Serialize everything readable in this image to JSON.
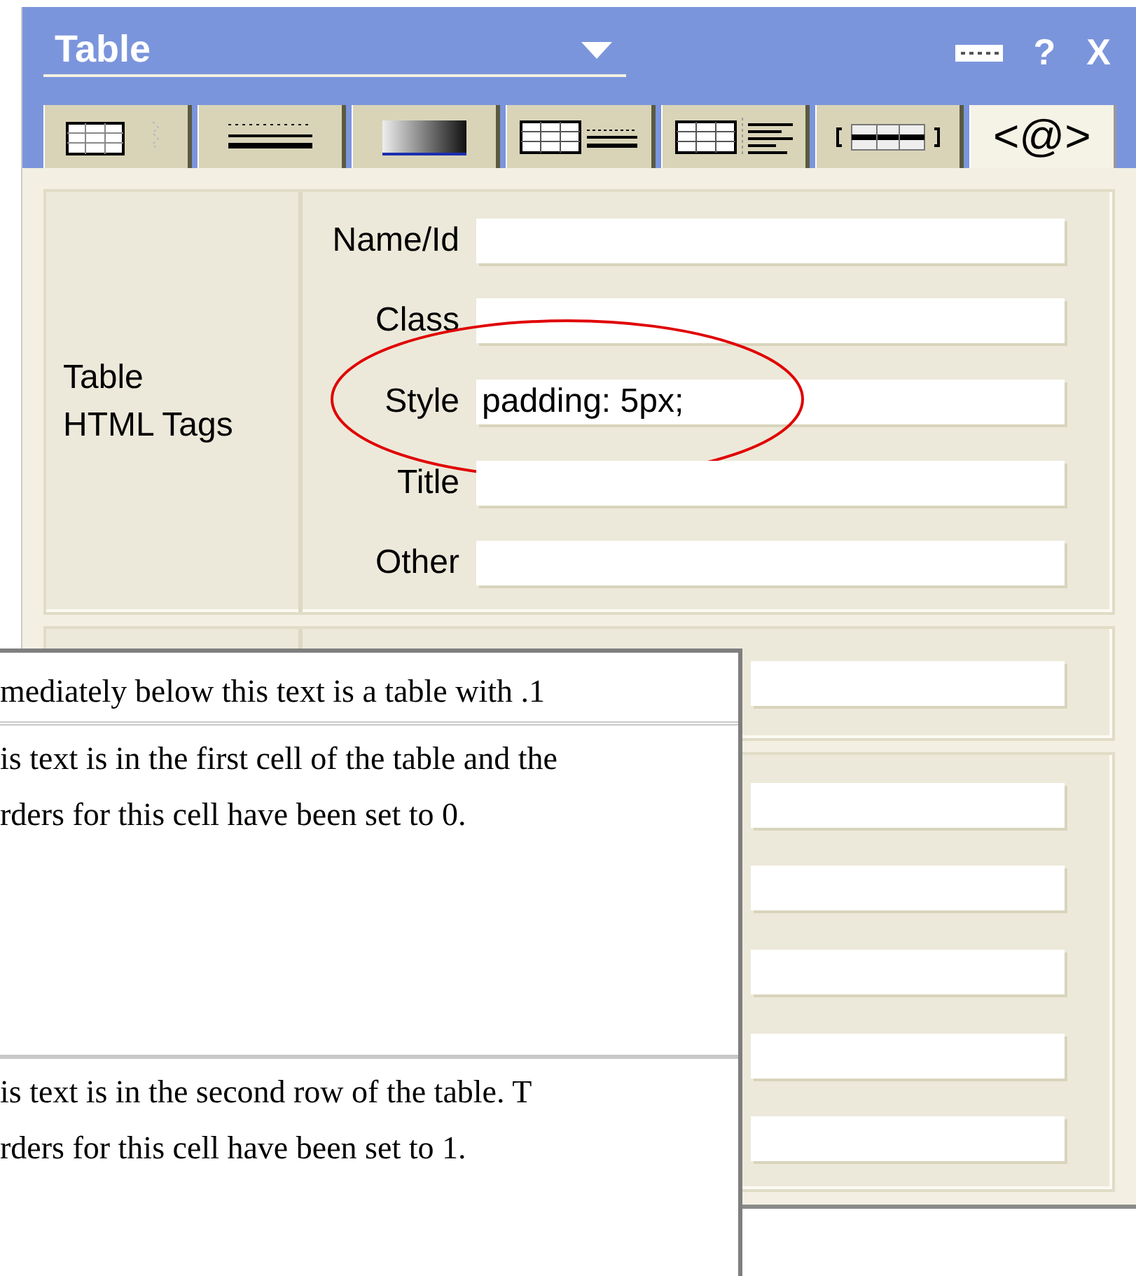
{
  "panel": {
    "title": "Table",
    "controls": [
      "?",
      "X"
    ],
    "tabs": [
      {
        "kind": "grid-marker",
        "selected": false
      },
      {
        "kind": "lines",
        "selected": false
      },
      {
        "kind": "gradient",
        "selected": false
      },
      {
        "kind": "grid-lines",
        "selected": false
      },
      {
        "kind": "grid-align",
        "selected": false
      },
      {
        "kind": "bracket-row",
        "selected": false
      },
      {
        "kind": "text",
        "label": "<@>",
        "selected": true
      }
    ],
    "sections": [
      {
        "label": [
          "Table",
          "HTML Tags"
        ],
        "fields": [
          {
            "label": "Name/Id"
          },
          {
            "label": "Class"
          },
          {
            "label": "Style",
            "value": "padding: 5px;",
            "annotated": true
          },
          {
            "label": "Title"
          },
          {
            "label": "Other"
          }
        ]
      },
      {
        "fields": [
          {
            "covered": true
          }
        ]
      },
      {
        "fields": [
          {
            "covered": true
          },
          {
            "covered": true
          },
          {
            "covered": true
          },
          {
            "covered": true
          },
          {
            "covered": true
          }
        ]
      }
    ]
  },
  "document": {
    "rows": [
      {
        "lines": [
          "mediately below this text is a table with .1"
        ]
      },
      {
        "lines": [
          "is text is in the first cell of the table and the",
          "rders for this cell have been set to 0."
        ]
      },
      {
        "lines": [
          "is text is in the second row of the table. T",
          "rders for this cell have been set to 1."
        ]
      }
    ]
  }
}
